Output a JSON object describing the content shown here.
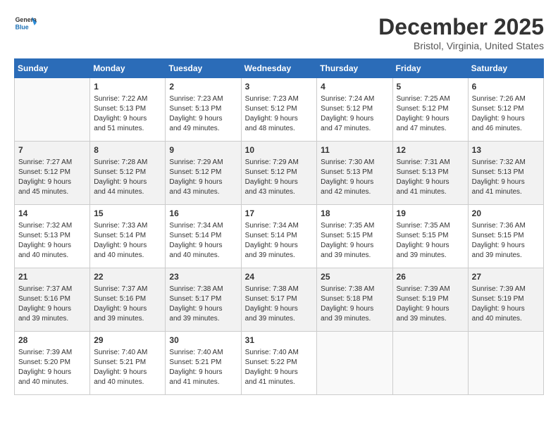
{
  "header": {
    "logo_line1": "General",
    "logo_line2": "Blue",
    "month": "December 2025",
    "location": "Bristol, Virginia, United States"
  },
  "weekdays": [
    "Sunday",
    "Monday",
    "Tuesday",
    "Wednesday",
    "Thursday",
    "Friday",
    "Saturday"
  ],
  "weeks": [
    [
      {
        "day": "",
        "info": ""
      },
      {
        "day": "1",
        "info": "Sunrise: 7:22 AM\nSunset: 5:13 PM\nDaylight: 9 hours\nand 51 minutes."
      },
      {
        "day": "2",
        "info": "Sunrise: 7:23 AM\nSunset: 5:13 PM\nDaylight: 9 hours\nand 49 minutes."
      },
      {
        "day": "3",
        "info": "Sunrise: 7:23 AM\nSunset: 5:12 PM\nDaylight: 9 hours\nand 48 minutes."
      },
      {
        "day": "4",
        "info": "Sunrise: 7:24 AM\nSunset: 5:12 PM\nDaylight: 9 hours\nand 47 minutes."
      },
      {
        "day": "5",
        "info": "Sunrise: 7:25 AM\nSunset: 5:12 PM\nDaylight: 9 hours\nand 47 minutes."
      },
      {
        "day": "6",
        "info": "Sunrise: 7:26 AM\nSunset: 5:12 PM\nDaylight: 9 hours\nand 46 minutes."
      }
    ],
    [
      {
        "day": "7",
        "info": "Sunrise: 7:27 AM\nSunset: 5:12 PM\nDaylight: 9 hours\nand 45 minutes."
      },
      {
        "day": "8",
        "info": "Sunrise: 7:28 AM\nSunset: 5:12 PM\nDaylight: 9 hours\nand 44 minutes."
      },
      {
        "day": "9",
        "info": "Sunrise: 7:29 AM\nSunset: 5:12 PM\nDaylight: 9 hours\nand 43 minutes."
      },
      {
        "day": "10",
        "info": "Sunrise: 7:29 AM\nSunset: 5:12 PM\nDaylight: 9 hours\nand 43 minutes."
      },
      {
        "day": "11",
        "info": "Sunrise: 7:30 AM\nSunset: 5:13 PM\nDaylight: 9 hours\nand 42 minutes."
      },
      {
        "day": "12",
        "info": "Sunrise: 7:31 AM\nSunset: 5:13 PM\nDaylight: 9 hours\nand 41 minutes."
      },
      {
        "day": "13",
        "info": "Sunrise: 7:32 AM\nSunset: 5:13 PM\nDaylight: 9 hours\nand 41 minutes."
      }
    ],
    [
      {
        "day": "14",
        "info": "Sunrise: 7:32 AM\nSunset: 5:13 PM\nDaylight: 9 hours\nand 40 minutes."
      },
      {
        "day": "15",
        "info": "Sunrise: 7:33 AM\nSunset: 5:14 PM\nDaylight: 9 hours\nand 40 minutes."
      },
      {
        "day": "16",
        "info": "Sunrise: 7:34 AM\nSunset: 5:14 PM\nDaylight: 9 hours\nand 40 minutes."
      },
      {
        "day": "17",
        "info": "Sunrise: 7:34 AM\nSunset: 5:14 PM\nDaylight: 9 hours\nand 39 minutes."
      },
      {
        "day": "18",
        "info": "Sunrise: 7:35 AM\nSunset: 5:15 PM\nDaylight: 9 hours\nand 39 minutes."
      },
      {
        "day": "19",
        "info": "Sunrise: 7:35 AM\nSunset: 5:15 PM\nDaylight: 9 hours\nand 39 minutes."
      },
      {
        "day": "20",
        "info": "Sunrise: 7:36 AM\nSunset: 5:15 PM\nDaylight: 9 hours\nand 39 minutes."
      }
    ],
    [
      {
        "day": "21",
        "info": "Sunrise: 7:37 AM\nSunset: 5:16 PM\nDaylight: 9 hours\nand 39 minutes."
      },
      {
        "day": "22",
        "info": "Sunrise: 7:37 AM\nSunset: 5:16 PM\nDaylight: 9 hours\nand 39 minutes."
      },
      {
        "day": "23",
        "info": "Sunrise: 7:38 AM\nSunset: 5:17 PM\nDaylight: 9 hours\nand 39 minutes."
      },
      {
        "day": "24",
        "info": "Sunrise: 7:38 AM\nSunset: 5:17 PM\nDaylight: 9 hours\nand 39 minutes."
      },
      {
        "day": "25",
        "info": "Sunrise: 7:38 AM\nSunset: 5:18 PM\nDaylight: 9 hours\nand 39 minutes."
      },
      {
        "day": "26",
        "info": "Sunrise: 7:39 AM\nSunset: 5:19 PM\nDaylight: 9 hours\nand 39 minutes."
      },
      {
        "day": "27",
        "info": "Sunrise: 7:39 AM\nSunset: 5:19 PM\nDaylight: 9 hours\nand 40 minutes."
      }
    ],
    [
      {
        "day": "28",
        "info": "Sunrise: 7:39 AM\nSunset: 5:20 PM\nDaylight: 9 hours\nand 40 minutes."
      },
      {
        "day": "29",
        "info": "Sunrise: 7:40 AM\nSunset: 5:21 PM\nDaylight: 9 hours\nand 40 minutes."
      },
      {
        "day": "30",
        "info": "Sunrise: 7:40 AM\nSunset: 5:21 PM\nDaylight: 9 hours\nand 41 minutes."
      },
      {
        "day": "31",
        "info": "Sunrise: 7:40 AM\nSunset: 5:22 PM\nDaylight: 9 hours\nand 41 minutes."
      },
      {
        "day": "",
        "info": ""
      },
      {
        "day": "",
        "info": ""
      },
      {
        "day": "",
        "info": ""
      }
    ]
  ]
}
